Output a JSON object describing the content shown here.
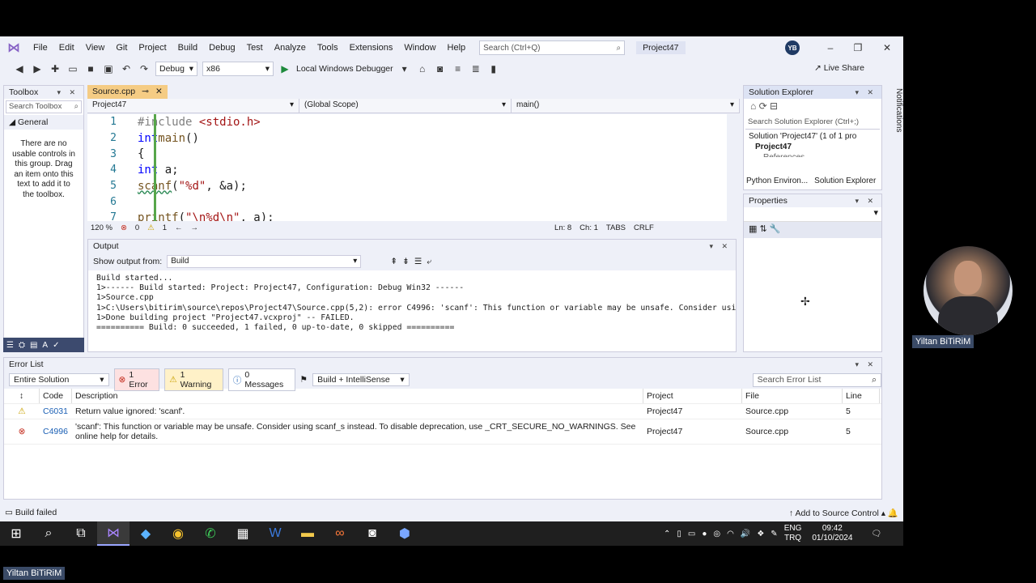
{
  "menu": [
    "File",
    "Edit",
    "View",
    "Git",
    "Project",
    "Build",
    "Debug",
    "Test",
    "Analyze",
    "Tools",
    "Extensions",
    "Window",
    "Help"
  ],
  "search_placeholder": "Search (Ctrl+Q)",
  "project_title": "Project47",
  "avatar_initials": "YB",
  "toolbar": {
    "config": "Debug",
    "platform": "x86",
    "run_label": "Local Windows Debugger",
    "live_share": "Live Share"
  },
  "toolbox": {
    "title": "Toolbox",
    "search": "Search Toolbox",
    "group": "General",
    "message": "There are no usable controls in this group. Drag an item onto this text to add it to the toolbox."
  },
  "editor": {
    "tab": "Source.cpp",
    "nav_project": "Project47",
    "nav_scope": "(Global Scope)",
    "nav_func": "main()",
    "zoom": "120 %",
    "errors": "0",
    "warnings": "1",
    "ln": "Ln: 8",
    "ch": "Ch: 1",
    "tabs": "TABS",
    "eol": "CRLF"
  },
  "output": {
    "title": "Output",
    "show_from_label": "Show output from:",
    "show_from_value": "Build",
    "text": "Build started...\n1>------ Build started: Project: Project47, Configuration: Debug Win32 ------\n1>Source.cpp\n1>C:\\Users\\bitirim\\source\\repos\\Project47\\Source.cpp(5,2): error C4996: 'scanf': This function or variable may be unsafe. Consider using\n1>Done building project \"Project47.vcxproj\" -- FAILED.\n========== Build: 0 succeeded, 1 failed, 0 up-to-date, 0 skipped =========="
  },
  "solution_explorer": {
    "title": "Solution Explorer",
    "search": "Search Solution Explorer (Ctrl+;)",
    "solution": "Solution 'Project47' (1 of 1 pro",
    "project": "Project47",
    "references": "References",
    "tab_python": "Python Environ...",
    "tab_solution": "Solution Explorer"
  },
  "properties_title": "Properties",
  "notifications": "Notifications",
  "error_list": {
    "title": "Error List",
    "scope": "Entire Solution",
    "errors": "1 Error",
    "warnings": "1 Warning",
    "messages": "0 Messages",
    "source": "Build + IntelliSense",
    "search": "Search Error List",
    "headers": {
      "code": "Code",
      "desc": "Description",
      "project": "Project",
      "file": "File",
      "line": "Line"
    },
    "rows": [
      {
        "code": "C6031",
        "desc": "Return value ignored: 'scanf'.",
        "project": "Project47",
        "file": "Source.cpp",
        "line": "5"
      },
      {
        "code": "C4996",
        "desc": "'scanf': This function or variable may be unsafe. Consider using scanf_s instead. To disable deprecation, use _CRT_SECURE_NO_WARNINGS. See online help for details.",
        "project": "Project47",
        "file": "Source.cpp",
        "line": "5"
      }
    ]
  },
  "status": {
    "left": "Build failed",
    "right": "Add to Source Control"
  },
  "tray": {
    "lang1": "ENG",
    "lang2": "TRQ",
    "time": "09:42",
    "date": "01/10/2024"
  },
  "presenter_name": "Yiltan BiTiRiM"
}
